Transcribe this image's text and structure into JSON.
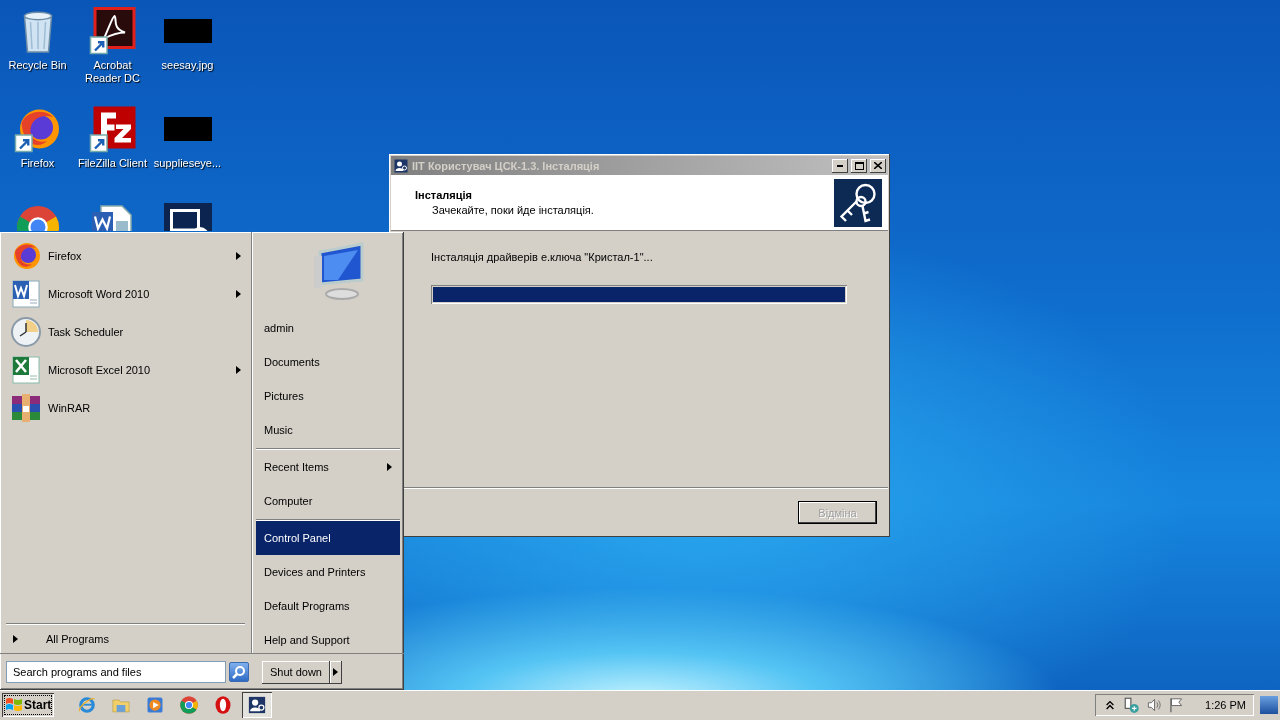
{
  "desktop_icons": [
    {
      "kind": "recycle",
      "label": "Recycle Bin"
    },
    {
      "kind": "reader",
      "label": "Acrobat Reader DC"
    },
    {
      "kind": "image",
      "label": "seesay.jpg"
    },
    {
      "kind": "firefox",
      "label": "Firefox"
    },
    {
      "kind": "filezilla",
      "label": "FileZilla Client"
    },
    {
      "kind": "image",
      "label": "supplieseye..."
    },
    {
      "kind": "chrome"
    },
    {
      "kind": "worddoc"
    },
    {
      "kind": "remote"
    }
  ],
  "dialog": {
    "title": "ІІТ Користувач ЦСК-1.3. Інсталяція",
    "header_title": "Інсталяція",
    "header_subtitle": "Зачекайте, поки йде інсталяція.",
    "status": "Інсталяція драйверів е.ключа \"Кристал-1\"...",
    "progress": {
      "level": 1
    },
    "buttons": [
      {
        "label": "Відміна",
        "disabled": true
      }
    ]
  },
  "start_menu": {
    "programs": [
      {
        "kind": "firefox",
        "label": "Firefox",
        "submenu": true
      },
      {
        "kind": "word",
        "label": "Microsoft Word 2010",
        "submenu": true
      },
      {
        "kind": "clock",
        "label": "Task Scheduler",
        "submenu": false
      },
      {
        "kind": "excel",
        "label": "Microsoft Excel 2010",
        "submenu": true
      },
      {
        "kind": "winrar",
        "label": "WinRAR",
        "submenu": false
      }
    ],
    "all_programs": "All Programs",
    "search": {
      "placeholder": "Search programs and files"
    },
    "place_groups": [
      [
        {
          "label": "admin",
          "selected": false,
          "submenu": false
        },
        {
          "label": "Documents",
          "selected": false,
          "submenu": false
        },
        {
          "label": "Pictures",
          "selected": false,
          "submenu": false
        },
        {
          "label": "Music",
          "selected": false,
          "submenu": false
        }
      ],
      [
        {
          "label": "Recent Items",
          "selected": false,
          "submenu": true
        },
        {
          "label": "Computer",
          "selected": false,
          "submenu": false
        }
      ],
      [
        {
          "label": "Control Panel",
          "selected": true,
          "submenu": false
        },
        {
          "label": "Devices and Printers",
          "selected": false,
          "submenu": false
        },
        {
          "label": "Default Programs",
          "selected": false,
          "submenu": false
        },
        {
          "label": "Help and Support",
          "selected": false,
          "submenu": false
        }
      ]
    ],
    "shutdown": "Shut down"
  },
  "taskbar": {
    "start": "Start",
    "apps": [
      {
        "kind": "ie",
        "selected": false
      },
      {
        "kind": "explorer",
        "selected": false
      },
      {
        "kind": "media",
        "selected": false
      },
      {
        "kind": "chrome",
        "selected": false
      },
      {
        "kind": "opera",
        "selected": false
      },
      {
        "kind": "installer",
        "selected": true
      }
    ],
    "tray": [
      {
        "kind": "expand"
      },
      {
        "kind": "network"
      },
      {
        "kind": "speaker"
      },
      {
        "kind": "flag"
      }
    ],
    "clock": "1:26 PM"
  }
}
